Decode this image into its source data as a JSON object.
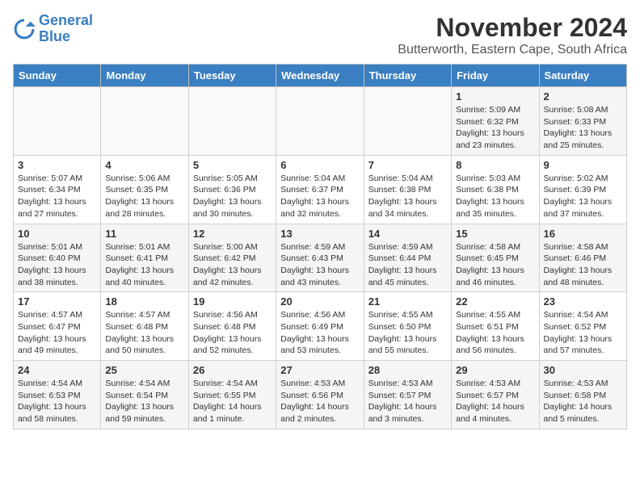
{
  "logo": {
    "line1": "General",
    "line2": "Blue"
  },
  "title": "November 2024",
  "subtitle": "Butterworth, Eastern Cape, South Africa",
  "days_of_week": [
    "Sunday",
    "Monday",
    "Tuesday",
    "Wednesday",
    "Thursday",
    "Friday",
    "Saturday"
  ],
  "weeks": [
    [
      {
        "day": "",
        "info": ""
      },
      {
        "day": "",
        "info": ""
      },
      {
        "day": "",
        "info": ""
      },
      {
        "day": "",
        "info": ""
      },
      {
        "day": "",
        "info": ""
      },
      {
        "day": "1",
        "info": "Sunrise: 5:09 AM\nSunset: 6:32 PM\nDaylight: 13 hours\nand 23 minutes."
      },
      {
        "day": "2",
        "info": "Sunrise: 5:08 AM\nSunset: 6:33 PM\nDaylight: 13 hours\nand 25 minutes."
      }
    ],
    [
      {
        "day": "3",
        "info": "Sunrise: 5:07 AM\nSunset: 6:34 PM\nDaylight: 13 hours\nand 27 minutes."
      },
      {
        "day": "4",
        "info": "Sunrise: 5:06 AM\nSunset: 6:35 PM\nDaylight: 13 hours\nand 28 minutes."
      },
      {
        "day": "5",
        "info": "Sunrise: 5:05 AM\nSunset: 6:36 PM\nDaylight: 13 hours\nand 30 minutes."
      },
      {
        "day": "6",
        "info": "Sunrise: 5:04 AM\nSunset: 6:37 PM\nDaylight: 13 hours\nand 32 minutes."
      },
      {
        "day": "7",
        "info": "Sunrise: 5:04 AM\nSunset: 6:38 PM\nDaylight: 13 hours\nand 34 minutes."
      },
      {
        "day": "8",
        "info": "Sunrise: 5:03 AM\nSunset: 6:38 PM\nDaylight: 13 hours\nand 35 minutes."
      },
      {
        "day": "9",
        "info": "Sunrise: 5:02 AM\nSunset: 6:39 PM\nDaylight: 13 hours\nand 37 minutes."
      }
    ],
    [
      {
        "day": "10",
        "info": "Sunrise: 5:01 AM\nSunset: 6:40 PM\nDaylight: 13 hours\nand 38 minutes."
      },
      {
        "day": "11",
        "info": "Sunrise: 5:01 AM\nSunset: 6:41 PM\nDaylight: 13 hours\nand 40 minutes."
      },
      {
        "day": "12",
        "info": "Sunrise: 5:00 AM\nSunset: 6:42 PM\nDaylight: 13 hours\nand 42 minutes."
      },
      {
        "day": "13",
        "info": "Sunrise: 4:59 AM\nSunset: 6:43 PM\nDaylight: 13 hours\nand 43 minutes."
      },
      {
        "day": "14",
        "info": "Sunrise: 4:59 AM\nSunset: 6:44 PM\nDaylight: 13 hours\nand 45 minutes."
      },
      {
        "day": "15",
        "info": "Sunrise: 4:58 AM\nSunset: 6:45 PM\nDaylight: 13 hours\nand 46 minutes."
      },
      {
        "day": "16",
        "info": "Sunrise: 4:58 AM\nSunset: 6:46 PM\nDaylight: 13 hours\nand 48 minutes."
      }
    ],
    [
      {
        "day": "17",
        "info": "Sunrise: 4:57 AM\nSunset: 6:47 PM\nDaylight: 13 hours\nand 49 minutes."
      },
      {
        "day": "18",
        "info": "Sunrise: 4:57 AM\nSunset: 6:48 PM\nDaylight: 13 hours\nand 50 minutes."
      },
      {
        "day": "19",
        "info": "Sunrise: 4:56 AM\nSunset: 6:48 PM\nDaylight: 13 hours\nand 52 minutes."
      },
      {
        "day": "20",
        "info": "Sunrise: 4:56 AM\nSunset: 6:49 PM\nDaylight: 13 hours\nand 53 minutes."
      },
      {
        "day": "21",
        "info": "Sunrise: 4:55 AM\nSunset: 6:50 PM\nDaylight: 13 hours\nand 55 minutes."
      },
      {
        "day": "22",
        "info": "Sunrise: 4:55 AM\nSunset: 6:51 PM\nDaylight: 13 hours\nand 56 minutes."
      },
      {
        "day": "23",
        "info": "Sunrise: 4:54 AM\nSunset: 6:52 PM\nDaylight: 13 hours\nand 57 minutes."
      }
    ],
    [
      {
        "day": "24",
        "info": "Sunrise: 4:54 AM\nSunset: 6:53 PM\nDaylight: 13 hours\nand 58 minutes."
      },
      {
        "day": "25",
        "info": "Sunrise: 4:54 AM\nSunset: 6:54 PM\nDaylight: 13 hours\nand 59 minutes."
      },
      {
        "day": "26",
        "info": "Sunrise: 4:54 AM\nSunset: 6:55 PM\nDaylight: 14 hours\nand 1 minute."
      },
      {
        "day": "27",
        "info": "Sunrise: 4:53 AM\nSunset: 6:56 PM\nDaylight: 14 hours\nand 2 minutes."
      },
      {
        "day": "28",
        "info": "Sunrise: 4:53 AM\nSunset: 6:57 PM\nDaylight: 14 hours\nand 3 minutes."
      },
      {
        "day": "29",
        "info": "Sunrise: 4:53 AM\nSunset: 6:57 PM\nDaylight: 14 hours\nand 4 minutes."
      },
      {
        "day": "30",
        "info": "Sunrise: 4:53 AM\nSunset: 6:58 PM\nDaylight: 14 hours\nand 5 minutes."
      }
    ]
  ]
}
